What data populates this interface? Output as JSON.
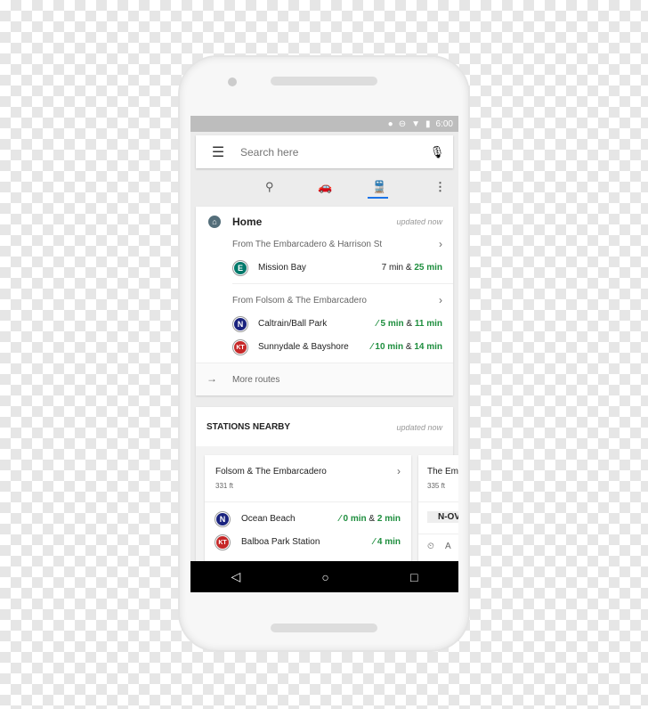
{
  "status_bar": {
    "time": "6:00",
    "icons": [
      "location-icon",
      "dnd-icon",
      "wifi-icon",
      "signal-icon",
      "battery-icon"
    ]
  },
  "search": {
    "placeholder": "Search here"
  },
  "modes": [
    {
      "icon": "explore-icon"
    },
    {
      "icon": "car-icon"
    },
    {
      "icon": "transit-icon",
      "active": true
    },
    {
      "icon": "more-icon"
    }
  ],
  "accent": "#1a73e8",
  "home": {
    "title": "Home",
    "updated": "updated now",
    "groups": [
      {
        "from": "From The Embarcadero & Harrison St",
        "routes": [
          {
            "badge": "E",
            "color": "#00796b",
            "dest": "Mission Bay",
            "t1": "7 min",
            "t2": "25 min",
            "t1_live": false
          }
        ]
      },
      {
        "from": "From Folsom & The Embarcadero",
        "routes": [
          {
            "badge": "N",
            "color": "#1a237e",
            "dest": "Caltrain/Ball Park",
            "t1": "5 min",
            "t2": "11 min",
            "t1_live": true
          },
          {
            "badge": "KT",
            "color": "#c62828",
            "dest": "Sunnydale & Bayshore",
            "t1": "10 min",
            "t2": "14 min",
            "t1_live": true
          }
        ]
      }
    ],
    "more": "More routes"
  },
  "amp": "&",
  "stations": {
    "title": "STATIONS NEARBY",
    "updated": "updated now",
    "cards": [
      {
        "name": "Folsom & The Embarcadero",
        "dist": "331 ft",
        "routes": [
          {
            "badge": "N",
            "dest": "Ocean Beach",
            "t1": "0 min",
            "t2": "2 min"
          },
          {
            "badge": "KT",
            "dest": "Balboa Park Station",
            "t1": "4 min"
          }
        ]
      },
      {
        "name": "The Em",
        "dist": "335 ft",
        "line": "N-OV",
        "extra": "A"
      }
    ]
  },
  "nav": {
    "back": "◁",
    "home": "○",
    "recent": "□"
  }
}
